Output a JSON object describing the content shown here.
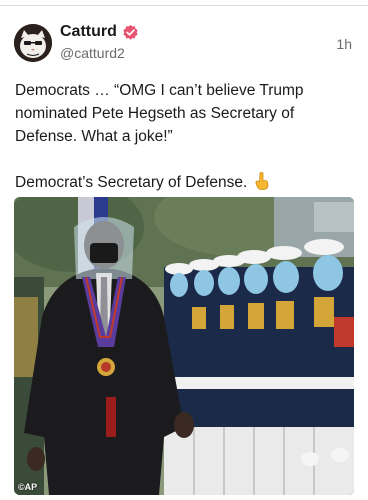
{
  "post": {
    "author": {
      "display_name": "Catturd",
      "handle": "@catturd2",
      "verified": true
    },
    "timestamp": "1h",
    "text_line1": "Democrats … “OMG I can’t believe Trump nominated Pete Hegseth as Secretary of Defense. What a joke!”",
    "text_line2": "Democrat’s Secretary of Defense.",
    "emoji": "pointing-down-emoji",
    "media": {
      "credit": "©AP"
    }
  },
  "colors": {
    "verified_badge": "#e8546f",
    "text": "#1a1a1a",
    "muted": "#6b6b6b"
  }
}
